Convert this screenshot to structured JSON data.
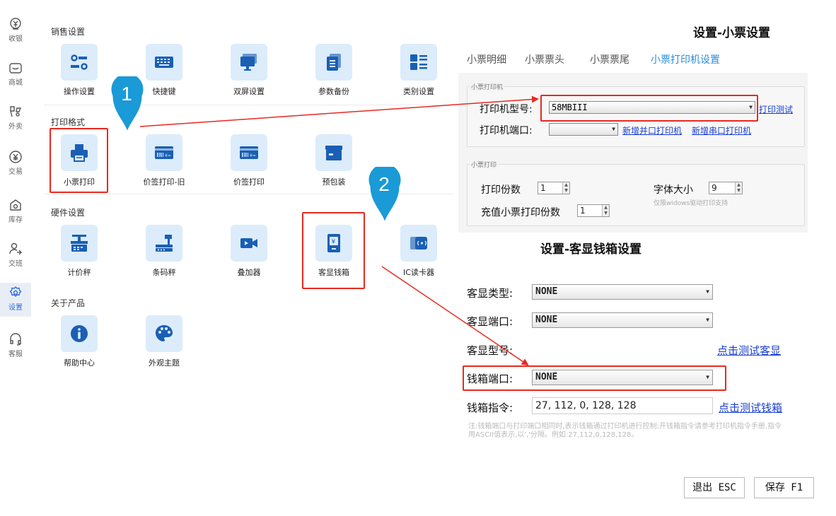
{
  "nav": [
    {
      "label": "收银",
      "icon": "cashier-icon"
    },
    {
      "label": "商城",
      "icon": "mall-icon"
    },
    {
      "label": "外卖",
      "icon": "takeout-icon"
    },
    {
      "label": "交易",
      "icon": "yuan-circle-icon"
    },
    {
      "label": "库存",
      "icon": "inventory-icon"
    },
    {
      "label": "交班",
      "icon": "handover-icon"
    },
    {
      "label": "设置",
      "icon": "gear-icon"
    },
    {
      "label": "客服",
      "icon": "headset-icon"
    }
  ],
  "sections": {
    "sales": "销售设置",
    "print": "打印格式",
    "hardware": "硬件设置",
    "about": "关于产品"
  },
  "tiles": {
    "sales": [
      "操作设置",
      "快捷键",
      "双屏设置",
      "参数备份",
      "类别设置"
    ],
    "print": [
      "小票打印",
      "价签打印-旧",
      "价签打印",
      "预包装"
    ],
    "hardware": [
      "计价秤",
      "条码秤",
      "叠加器",
      "客显钱箱",
      "IC读卡器"
    ],
    "about": [
      "帮助中心",
      "外观主题"
    ]
  },
  "markers": [
    "1",
    "2"
  ],
  "receipt": {
    "title": "设置-小票设置",
    "tabs": [
      "小票明细",
      "小票票头",
      "小票票尾",
      "小票打印机设置"
    ],
    "printer_group": "小票打印机",
    "printer_model_label": "打印机型号:",
    "printer_model_value": "58MBIII",
    "print_test": "打印测试",
    "printer_port_label": "打印机端口:",
    "printer_port_value": "",
    "add_parallel": "新增并口打印机",
    "add_serial": "新增串口打印机",
    "copies_group": "小票打印",
    "copies_label": "打印份数",
    "copies_value": "1",
    "font_label": "字体大小",
    "font_value": "9",
    "font_hint": "仅限widows驱动打印支持",
    "recharge_label": "充值小票打印份数",
    "recharge_value": "1"
  },
  "display": {
    "title": "设置-客显钱箱设置",
    "type_label": "客显类型:",
    "type_value": "NONE",
    "port_label": "客显端口:",
    "port_value": "NONE",
    "model_label": "客显型号:",
    "test_display": "点击测试客显",
    "drawer_port_label": "钱箱端口:",
    "drawer_port_value": "NONE",
    "drawer_cmd_label": "钱箱指令:",
    "drawer_cmd_value": "27, 112, 0, 128, 128",
    "test_drawer": "点击测试钱箱",
    "note": "注:钱箱端口与打印端口相同时,表示钱箱通过打印机进行控制;开钱箱指令请参考打印机指令手册,指令用ASCII值表示,以','分隔。例如:27,112,0,128,128。"
  },
  "buttons": {
    "exit": "退出 ESC",
    "save": "保存 F1"
  },
  "colors": {
    "accent": "#2a6fdb",
    "tile_bg": "#dcecfb",
    "tile_icon": "#1a5fb4",
    "marker": "#1a9ad6",
    "highlight": "#e8291f"
  }
}
